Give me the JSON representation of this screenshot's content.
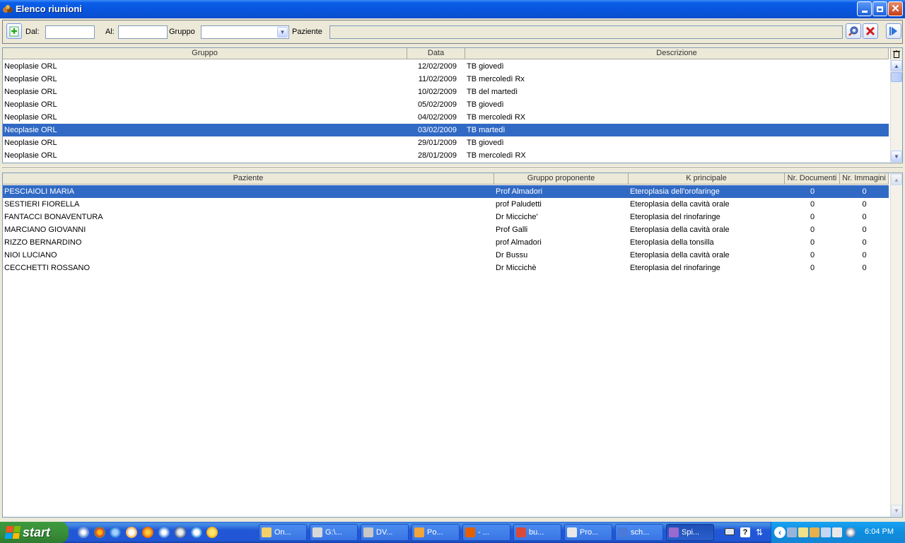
{
  "window": {
    "title": "Elenco riunioni"
  },
  "colors": {
    "titlebar": "#0854dd",
    "selection": "#316ac5",
    "taskbar": "#2157d7",
    "start": "#3a8f3a"
  },
  "toolbar": {
    "new_icon": "add-document-icon",
    "dal_label": "Dal:",
    "dal_value": "",
    "al_label": "Al:",
    "al_value": "",
    "gruppo_label": "Gruppo",
    "gruppo_value": "",
    "paziente_label": "Paziente",
    "paziente_value": "",
    "search_icon": "search-icon",
    "clear_icon": "close-icon",
    "next_icon": "play-icon"
  },
  "meetings": {
    "columns": [
      "Gruppo",
      "Data",
      "Descrizione"
    ],
    "rows": [
      {
        "gruppo": "Neoplasie ORL",
        "data": "12/02/2009",
        "descrizione": "TB giovedì"
      },
      {
        "gruppo": "Neoplasie ORL",
        "data": "11/02/2009",
        "descrizione": "TB mercoledì Rx"
      },
      {
        "gruppo": "Neoplasie ORL",
        "data": "10/02/2009",
        "descrizione": "TB del martedì"
      },
      {
        "gruppo": "Neoplasie ORL",
        "data": "05/02/2009",
        "descrizione": "TB giovedì"
      },
      {
        "gruppo": "Neoplasie ORL",
        "data": "04/02/2009",
        "descrizione": "TB mercoledi RX"
      },
      {
        "gruppo": "Neoplasie ORL",
        "data": "03/02/2009",
        "descrizione": "TB martedì",
        "selected": true
      },
      {
        "gruppo": "Neoplasie ORL",
        "data": "29/01/2009",
        "descrizione": "TB giovedì"
      },
      {
        "gruppo": "Neoplasie ORL",
        "data": "28/01/2009",
        "descrizione": "TB mercoledì RX"
      }
    ]
  },
  "patients": {
    "columns": [
      "Paziente",
      "Gruppo proponente",
      "K principale",
      "Nr. Documenti",
      "Nr. Immagini"
    ],
    "rows": [
      {
        "paziente": "PESCIAIOLI MARIA",
        "gruppo": "Prof Almadori",
        "k": "Eteroplasia dell'orofaringe",
        "doc": "0",
        "img": "0",
        "selected": true
      },
      {
        "paziente": "SESTIERI FIORELLA",
        "gruppo": "prof Paludetti",
        "k": "Eteroplasia della cavità orale",
        "doc": "0",
        "img": "0"
      },
      {
        "paziente": "FANTACCI BONAVENTURA",
        "gruppo": "Dr Micciche'",
        "k": "Eteroplasia del rinofaringe",
        "doc": "0",
        "img": "0"
      },
      {
        "paziente": "MARCIANO GIOVANNI",
        "gruppo": "Prof Galli",
        "k": "Eteroplasia della cavità orale",
        "doc": "0",
        "img": "0"
      },
      {
        "paziente": "RIZZO BERNARDINO",
        "gruppo": "prof Almadori",
        "k": "Eteroplasia della tonsilla",
        "doc": "0",
        "img": "0"
      },
      {
        "paziente": "NIOI LUCIANO",
        "gruppo": "Dr Bussu",
        "k": "Eteroplasia della cavità orale",
        "doc": "0",
        "img": "0"
      },
      {
        "paziente": "CECCHETTI ROSSANO",
        "gruppo": "Dr Miccichè",
        "k": "Eteroplasia del rinofaringe",
        "doc": "0",
        "img": "0"
      }
    ]
  },
  "taskbar": {
    "start_label": "start",
    "tasks": [
      {
        "label": "On...",
        "icon": "app-icon"
      },
      {
        "label": "G:\\...",
        "icon": "folder-icon"
      },
      {
        "label": "DV...",
        "icon": "dvd-icon"
      },
      {
        "label": "Po...",
        "icon": "mail-icon"
      },
      {
        "label": "- ...",
        "icon": "firefox-icon"
      },
      {
        "label": "bu...",
        "icon": "document-icon"
      },
      {
        "label": "Pro...",
        "icon": "pdf-icon"
      },
      {
        "label": "sch...",
        "icon": "word-icon"
      },
      {
        "label": "Spi...",
        "icon": "app-icon",
        "active": true
      }
    ],
    "clock": "6:04 PM"
  }
}
